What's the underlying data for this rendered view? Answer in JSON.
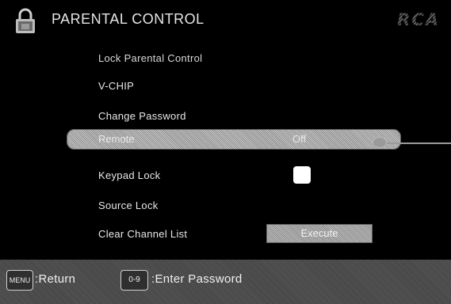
{
  "header": {
    "title": "PARENTAL CONTROL",
    "brand": "RCA",
    "icon": "padlock-icon"
  },
  "menu": {
    "items": [
      {
        "label": "Lock Parental Control"
      },
      {
        "label": "V-CHIP"
      },
      {
        "label": "Change Password"
      },
      {
        "label": "Remote",
        "value": "Off",
        "selected": true
      },
      {
        "label": "Keypad Lock",
        "control": "checkbox",
        "checked": false
      },
      {
        "label": "Source Lock"
      },
      {
        "label": "Clear Channel List",
        "control": "button",
        "button_label": "Execute"
      }
    ]
  },
  "footer": {
    "menu_key": "MENU",
    "return_label": ":Return",
    "number_key": "0-9",
    "enter_label": ":Enter Password"
  },
  "colors": {
    "background": "#000000",
    "text": "#e8e8e8",
    "highlight": "#a8a8a8",
    "footer": "#4a4a4a"
  }
}
